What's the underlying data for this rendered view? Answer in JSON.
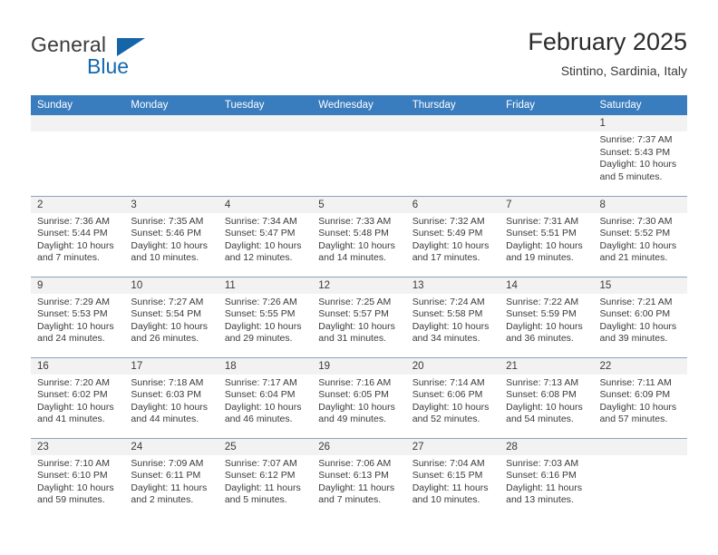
{
  "brand": {
    "word1": "General",
    "word2": "Blue",
    "triangle_color": "#1565a8",
    "blue_color": "#1668ad"
  },
  "header": {
    "title": "February 2025",
    "subtitle": "Stintino, Sardinia, Italy"
  },
  "theme": {
    "header_bg": "#3a7dbf",
    "daynum_bg": "#f2f2f2",
    "row_line": "#8ba4bd",
    "text": "#3a3a3a"
  },
  "weekdays": [
    "Sunday",
    "Monday",
    "Tuesday",
    "Wednesday",
    "Thursday",
    "Friday",
    "Saturday"
  ],
  "labels": {
    "sunrise": "Sunrise:",
    "sunset": "Sunset:",
    "daylight": "Daylight:"
  },
  "weeks": [
    [
      {
        "day": "",
        "blank": true
      },
      {
        "day": "",
        "blank": true
      },
      {
        "day": "",
        "blank": true
      },
      {
        "day": "",
        "blank": true
      },
      {
        "day": "",
        "blank": true
      },
      {
        "day": "",
        "blank": true
      },
      {
        "day": "1",
        "sunrise": "Sunrise: 7:37 AM",
        "sunset": "Sunset: 5:43 PM",
        "daylight": "Daylight: 10 hours and 5 minutes."
      }
    ],
    [
      {
        "day": "2",
        "sunrise": "Sunrise: 7:36 AM",
        "sunset": "Sunset: 5:44 PM",
        "daylight": "Daylight: 10 hours and 7 minutes."
      },
      {
        "day": "3",
        "sunrise": "Sunrise: 7:35 AM",
        "sunset": "Sunset: 5:46 PM",
        "daylight": "Daylight: 10 hours and 10 minutes."
      },
      {
        "day": "4",
        "sunrise": "Sunrise: 7:34 AM",
        "sunset": "Sunset: 5:47 PM",
        "daylight": "Daylight: 10 hours and 12 minutes."
      },
      {
        "day": "5",
        "sunrise": "Sunrise: 7:33 AM",
        "sunset": "Sunset: 5:48 PM",
        "daylight": "Daylight: 10 hours and 14 minutes."
      },
      {
        "day": "6",
        "sunrise": "Sunrise: 7:32 AM",
        "sunset": "Sunset: 5:49 PM",
        "daylight": "Daylight: 10 hours and 17 minutes."
      },
      {
        "day": "7",
        "sunrise": "Sunrise: 7:31 AM",
        "sunset": "Sunset: 5:51 PM",
        "daylight": "Daylight: 10 hours and 19 minutes."
      },
      {
        "day": "8",
        "sunrise": "Sunrise: 7:30 AM",
        "sunset": "Sunset: 5:52 PM",
        "daylight": "Daylight: 10 hours and 21 minutes."
      }
    ],
    [
      {
        "day": "9",
        "sunrise": "Sunrise: 7:29 AM",
        "sunset": "Sunset: 5:53 PM",
        "daylight": "Daylight: 10 hours and 24 minutes."
      },
      {
        "day": "10",
        "sunrise": "Sunrise: 7:27 AM",
        "sunset": "Sunset: 5:54 PM",
        "daylight": "Daylight: 10 hours and 26 minutes."
      },
      {
        "day": "11",
        "sunrise": "Sunrise: 7:26 AM",
        "sunset": "Sunset: 5:55 PM",
        "daylight": "Daylight: 10 hours and 29 minutes."
      },
      {
        "day": "12",
        "sunrise": "Sunrise: 7:25 AM",
        "sunset": "Sunset: 5:57 PM",
        "daylight": "Daylight: 10 hours and 31 minutes."
      },
      {
        "day": "13",
        "sunrise": "Sunrise: 7:24 AM",
        "sunset": "Sunset: 5:58 PM",
        "daylight": "Daylight: 10 hours and 34 minutes."
      },
      {
        "day": "14",
        "sunrise": "Sunrise: 7:22 AM",
        "sunset": "Sunset: 5:59 PM",
        "daylight": "Daylight: 10 hours and 36 minutes."
      },
      {
        "day": "15",
        "sunrise": "Sunrise: 7:21 AM",
        "sunset": "Sunset: 6:00 PM",
        "daylight": "Daylight: 10 hours and 39 minutes."
      }
    ],
    [
      {
        "day": "16",
        "sunrise": "Sunrise: 7:20 AM",
        "sunset": "Sunset: 6:02 PM",
        "daylight": "Daylight: 10 hours and 41 minutes."
      },
      {
        "day": "17",
        "sunrise": "Sunrise: 7:18 AM",
        "sunset": "Sunset: 6:03 PM",
        "daylight": "Daylight: 10 hours and 44 minutes."
      },
      {
        "day": "18",
        "sunrise": "Sunrise: 7:17 AM",
        "sunset": "Sunset: 6:04 PM",
        "daylight": "Daylight: 10 hours and 46 minutes."
      },
      {
        "day": "19",
        "sunrise": "Sunrise: 7:16 AM",
        "sunset": "Sunset: 6:05 PM",
        "daylight": "Daylight: 10 hours and 49 minutes."
      },
      {
        "day": "20",
        "sunrise": "Sunrise: 7:14 AM",
        "sunset": "Sunset: 6:06 PM",
        "daylight": "Daylight: 10 hours and 52 minutes."
      },
      {
        "day": "21",
        "sunrise": "Sunrise: 7:13 AM",
        "sunset": "Sunset: 6:08 PM",
        "daylight": "Daylight: 10 hours and 54 minutes."
      },
      {
        "day": "22",
        "sunrise": "Sunrise: 7:11 AM",
        "sunset": "Sunset: 6:09 PM",
        "daylight": "Daylight: 10 hours and 57 minutes."
      }
    ],
    [
      {
        "day": "23",
        "sunrise": "Sunrise: 7:10 AM",
        "sunset": "Sunset: 6:10 PM",
        "daylight": "Daylight: 10 hours and 59 minutes."
      },
      {
        "day": "24",
        "sunrise": "Sunrise: 7:09 AM",
        "sunset": "Sunset: 6:11 PM",
        "daylight": "Daylight: 11 hours and 2 minutes."
      },
      {
        "day": "25",
        "sunrise": "Sunrise: 7:07 AM",
        "sunset": "Sunset: 6:12 PM",
        "daylight": "Daylight: 11 hours and 5 minutes."
      },
      {
        "day": "26",
        "sunrise": "Sunrise: 7:06 AM",
        "sunset": "Sunset: 6:13 PM",
        "daylight": "Daylight: 11 hours and 7 minutes."
      },
      {
        "day": "27",
        "sunrise": "Sunrise: 7:04 AM",
        "sunset": "Sunset: 6:15 PM",
        "daylight": "Daylight: 11 hours and 10 minutes."
      },
      {
        "day": "28",
        "sunrise": "Sunrise: 7:03 AM",
        "sunset": "Sunset: 6:16 PM",
        "daylight": "Daylight: 11 hours and 13 minutes."
      },
      {
        "day": "",
        "blank": true
      }
    ]
  ]
}
